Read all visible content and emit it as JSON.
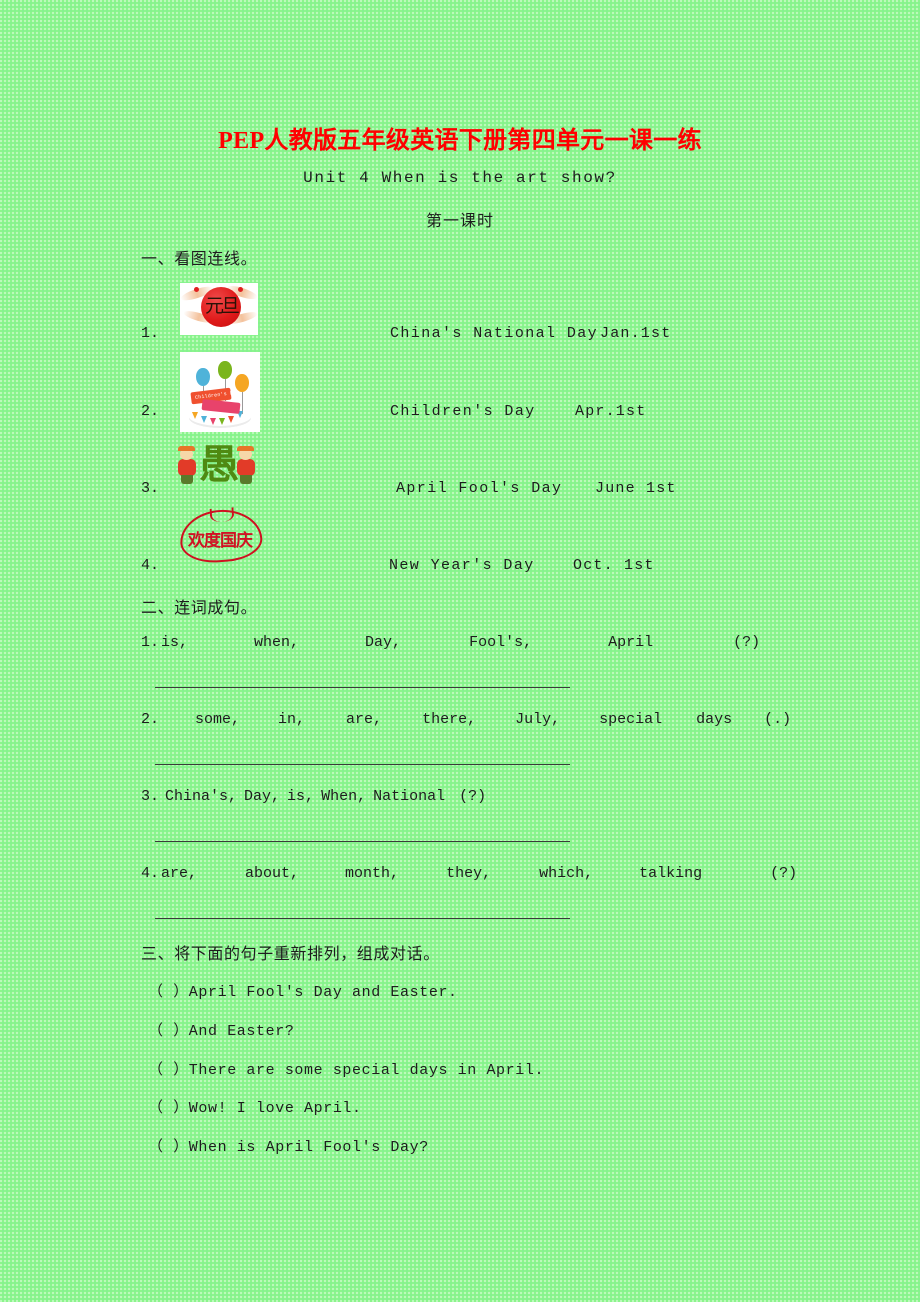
{
  "document": {
    "title": "PEP人教版五年级英语下册第四单元一课一练",
    "unit_line": "Unit 4  When is the art show?",
    "lesson_line": "第一课时"
  },
  "section1": {
    "heading": "一、看图连线。",
    "rows": [
      {
        "number": "1.",
        "image_name": "new-year-picture",
        "image_caption": "元旦",
        "term": "China's National Day",
        "date": "Jan.1st"
      },
      {
        "number": "2.",
        "image_name": "childrens-day-picture",
        "image_caption": "Children's Day",
        "term": "Children's Day",
        "date": "Apr.1st"
      },
      {
        "number": "3.",
        "image_name": "april-fool-picture",
        "image_caption": "愚",
        "term": "April Fool's Day",
        "date": "June 1st"
      },
      {
        "number": "4.",
        "image_name": "national-day-picture",
        "image_caption": "欢度国庆",
        "term": "New Year's Day",
        "date": "Oct. 1st"
      }
    ]
  },
  "section2": {
    "heading": "二、连词成句。",
    "items": [
      {
        "number": "1.",
        "tokens": [
          "is,",
          "when,",
          "Day,",
          "Fool's,",
          "April",
          "(?)"
        ]
      },
      {
        "number": "2.",
        "tokens": [
          "some,",
          "in,",
          "are,",
          "there,",
          "July,",
          "special",
          "days",
          "(.)"
        ]
      },
      {
        "number": "3.",
        "tokens": [
          "China's,",
          "Day,",
          "is,",
          "When,",
          "National",
          "(?)"
        ]
      },
      {
        "number": "4.",
        "tokens": [
          "are,",
          "about,",
          "month,",
          "they,",
          "which,",
          "talking",
          "(?)"
        ]
      }
    ]
  },
  "section3": {
    "heading": "三、将下面的句子重新排列，组成对话。",
    "lines": [
      "（ ）April Fool's Day and Easter.",
      "（ ）And Easter?",
      "（ ）There are some special days in April.",
      "（ ）Wow! I love April.",
      "（ ）When is April Fool's Day?"
    ]
  },
  "colors": {
    "page_background": "#8CF58C",
    "title_red": "#FF0000",
    "body_text": "#1d1d1d",
    "rule_line": "#3a3a3a"
  }
}
